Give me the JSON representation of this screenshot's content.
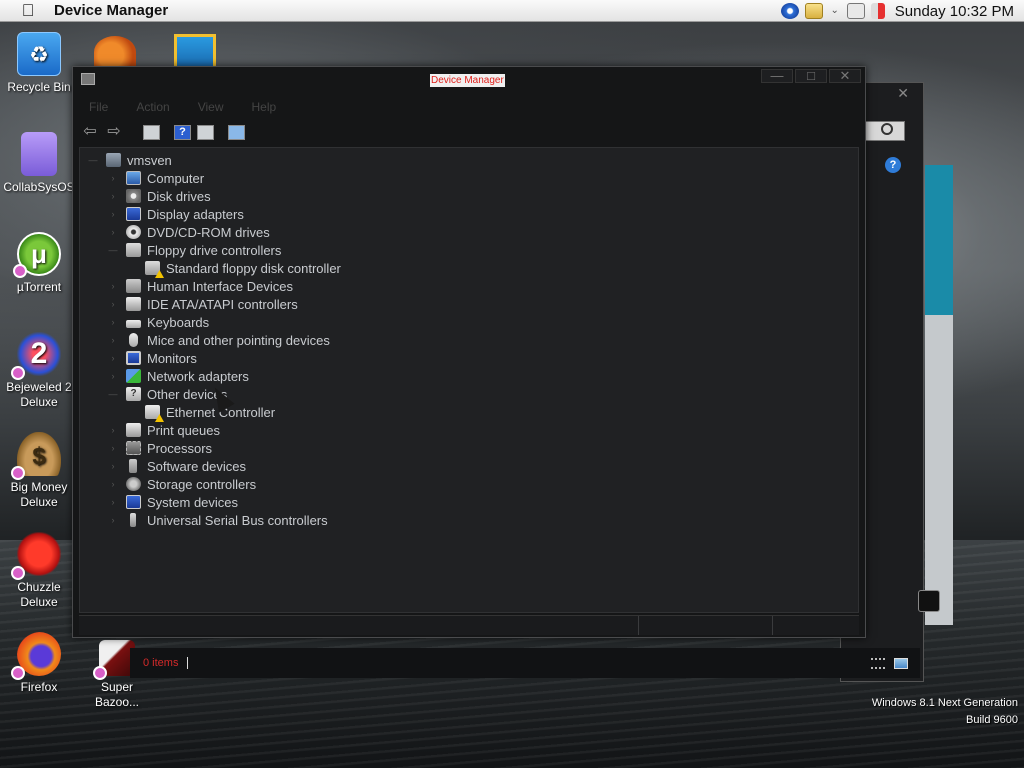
{
  "menubar": {
    "app_title": "Device Manager",
    "clock": "Sunday 10:32 PM"
  },
  "desktop_icons": [
    {
      "label": "Recycle Bin",
      "icon": "recycle-bin-icon",
      "color": "#2a8ae0"
    },
    {
      "label": "CollabSysOS",
      "icon": "collabsysos-icon",
      "color": "#9a7ce8"
    },
    {
      "label": "µTorrent",
      "icon": "utorrent-icon",
      "color": "#55aa22"
    },
    {
      "label": "Bejeweled 2 Deluxe",
      "icon": "bejeweled-icon",
      "color": "#c02030"
    },
    {
      "label": "Big Money Deluxe",
      "icon": "money-bag-icon",
      "color": "#a27a3a"
    },
    {
      "label": "Chuzzle Deluxe",
      "icon": "chuzzle-icon",
      "color": "#d02020"
    },
    {
      "label": "Firefox",
      "icon": "firefox-icon",
      "color": "#e86a1a"
    },
    {
      "label": "Super Bazoo...",
      "icon": "super-bazooka-icon",
      "color": "#8a1a1a"
    }
  ],
  "window": {
    "title": "Device Manager",
    "menu": [
      "File",
      "Action",
      "View",
      "Help"
    ]
  },
  "tree": {
    "root": "vmsven",
    "items": [
      {
        "label": "Computer",
        "icon": "computer-icon"
      },
      {
        "label": "Disk drives",
        "icon": "disk-drive-icon"
      },
      {
        "label": "Display adapters",
        "icon": "display-adapter-icon"
      },
      {
        "label": "DVD/CD-ROM drives",
        "icon": "dvd-drive-icon"
      },
      {
        "label": "Floppy drive controllers",
        "icon": "floppy-controller-icon"
      },
      {
        "label": "Standard floppy disk controller",
        "icon": "floppy-device-warning-icon"
      },
      {
        "label": "Human Interface Devices",
        "icon": "hid-icon"
      },
      {
        "label": "IDE ATA/ATAPI controllers",
        "icon": "ide-controller-icon"
      },
      {
        "label": "Keyboards",
        "icon": "keyboard-icon"
      },
      {
        "label": "Mice and other pointing devices",
        "icon": "mouse-icon"
      },
      {
        "label": "Monitors",
        "icon": "monitor-icon"
      },
      {
        "label": "Network adapters",
        "icon": "network-adapter-icon"
      },
      {
        "label": "Other devices",
        "icon": "other-devices-icon"
      },
      {
        "label": "Ethernet Controller",
        "icon": "ethernet-warning-icon"
      },
      {
        "label": "Print queues",
        "icon": "print-queue-icon"
      },
      {
        "label": "Processors",
        "icon": "processor-icon"
      },
      {
        "label": "Software devices",
        "icon": "software-device-icon"
      },
      {
        "label": "Storage controllers",
        "icon": "storage-controller-icon"
      },
      {
        "label": "System devices",
        "icon": "system-device-icon"
      },
      {
        "label": "Universal Serial Bus controllers",
        "icon": "usb-icon"
      }
    ]
  },
  "file_browser": {
    "items_count": "0 items"
  },
  "watermark": {
    "line1": "Windows 8.1 Next Generation",
    "line2": "Build 9600"
  },
  "colors": {
    "title_text": "#e0201b",
    "tree_text": "#c9ccd0",
    "window_bg": "#151617",
    "status_text": "#d42a2a"
  }
}
